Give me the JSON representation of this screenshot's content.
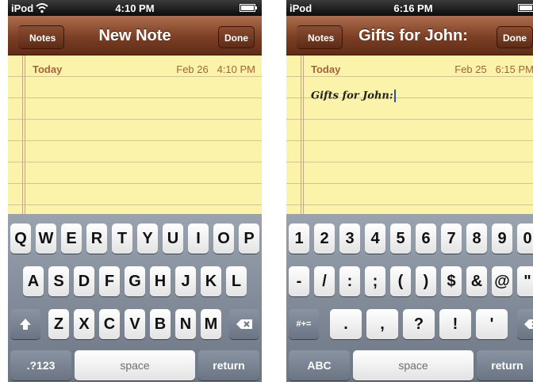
{
  "left": {
    "status": {
      "carrier": "iPod",
      "time": "4:10 PM"
    },
    "nav": {
      "back_label": "Notes",
      "title": "New Note",
      "done_label": "Done"
    },
    "note": {
      "day": "Today",
      "date": "Feb 26",
      "time": "4:10 PM",
      "text": ""
    },
    "keyboard": {
      "row1": [
        "Q",
        "W",
        "E",
        "R",
        "T",
        "Y",
        "U",
        "I",
        "O",
        "P"
      ],
      "row2": [
        "A",
        "S",
        "D",
        "F",
        "G",
        "H",
        "J",
        "K",
        "L"
      ],
      "row3": [
        "Z",
        "X",
        "C",
        "V",
        "B",
        "N",
        "M"
      ],
      "mode_label": ".?123",
      "space_label": "space",
      "return_label": "return"
    }
  },
  "right": {
    "status": {
      "carrier": "iPod",
      "time": "6:16 PM"
    },
    "nav": {
      "back_label": "Notes",
      "title": "Gifts for John:",
      "done_label": "Done"
    },
    "note": {
      "day": "Today",
      "date": "Feb 25",
      "time": "6:15 PM",
      "text": "Gifts for John:"
    },
    "keyboard": {
      "row1": [
        "1",
        "2",
        "3",
        "4",
        "5",
        "6",
        "7",
        "8",
        "9",
        "0"
      ],
      "row2": [
        "-",
        "/",
        ":",
        ";",
        "(",
        ")",
        "$",
        "&",
        "@",
        "\""
      ],
      "row3": [
        ".",
        ",",
        "?",
        "!",
        "'"
      ],
      "mode_label": "#+=",
      "abc_label": "ABC",
      "space_label": "space",
      "return_label": "return"
    }
  },
  "icons": {
    "wifi": "wifi-icon",
    "battery": "battery-icon",
    "shift": "shift-icon",
    "delete": "delete-icon"
  },
  "colors": {
    "nav": "#7b3f24",
    "paper": "#fbf3a9",
    "date_text": "#a8613d",
    "keyboard": "#7d8694"
  }
}
